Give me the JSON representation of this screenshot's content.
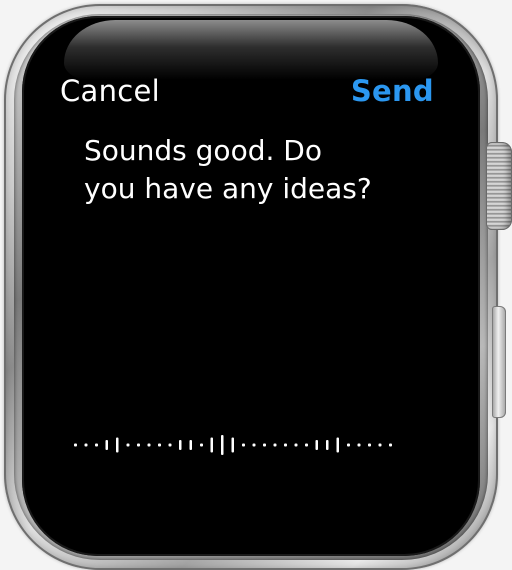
{
  "dictation": {
    "cancel_label": "Cancel",
    "send_label": "Send",
    "message_lines": [
      "Sounds good. Do",
      "you have any ideas?"
    ]
  },
  "colors": {
    "accent": "#2b97f0",
    "text": "#ffffff",
    "screen": "#000000"
  },
  "icons": {
    "waveform": "audio-waveform-icon"
  }
}
